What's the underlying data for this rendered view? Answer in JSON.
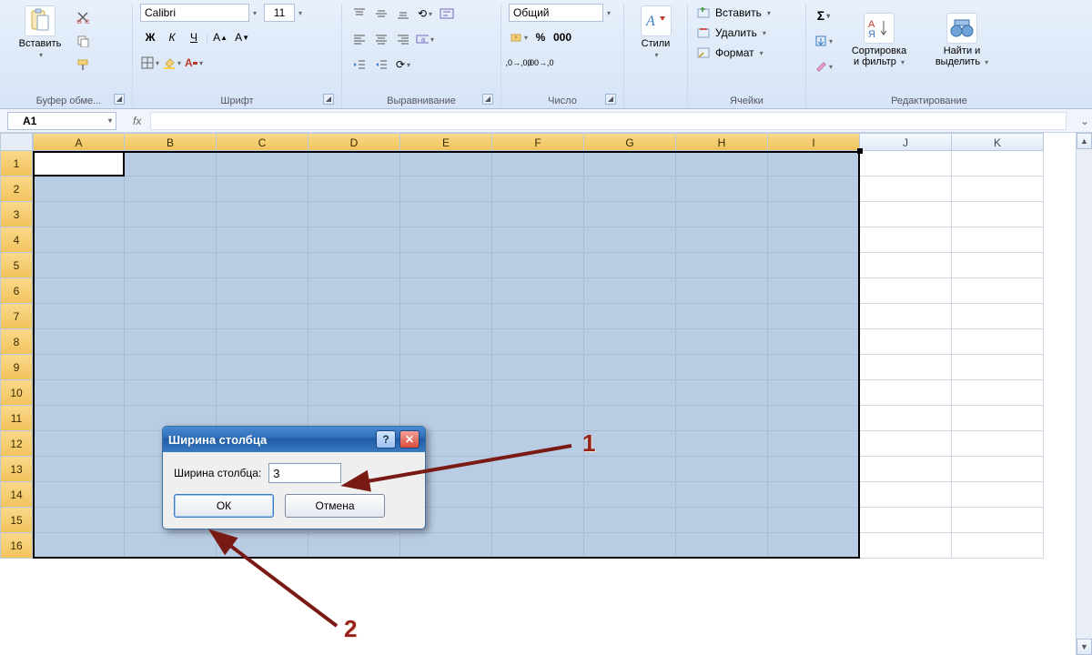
{
  "ribbon": {
    "font_name": "Calibri",
    "font_size": "11",
    "number_format": "Общий",
    "paste": "Вставить",
    "bold": "Ж",
    "italic": "К",
    "underline": "Ч",
    "styles": "Стили",
    "insert": "Вставить",
    "delete": "Удалить",
    "format": "Формат",
    "sort_filter_l1": "Сортировка",
    "sort_filter_l2": "и фильтр",
    "find_l1": "Найти и",
    "find_l2": "выделить",
    "groups": {
      "clipboard": "Буфер обме...",
      "font": "Шрифт",
      "alignment": "Выравнивание",
      "number": "Число",
      "cells": "Ячейки",
      "editing": "Редактирование"
    }
  },
  "formula_bar": {
    "cell_ref": "A1",
    "fx": "fx"
  },
  "grid": {
    "columns": [
      "A",
      "B",
      "C",
      "D",
      "E",
      "F",
      "G",
      "H",
      "I",
      "J",
      "K"
    ],
    "rows": [
      "1",
      "2",
      "3",
      "4",
      "5",
      "6",
      "7",
      "8",
      "9",
      "10",
      "11",
      "12",
      "13",
      "14",
      "15",
      "16"
    ],
    "selected_cols": 9,
    "selected_rows": 16
  },
  "dialog": {
    "title": "Ширина столбца",
    "label": "Ширина столбца:",
    "value": "3",
    "ok": "ОК",
    "cancel": "Отмена"
  },
  "annotations": {
    "one": "1",
    "two": "2"
  }
}
